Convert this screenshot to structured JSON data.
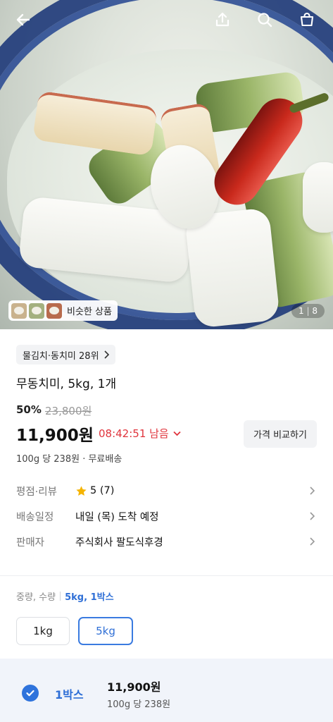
{
  "hero": {
    "similar_label": "비슷한 상품",
    "counter_current": "1",
    "counter_total": "8"
  },
  "icons": {
    "back": "back-arrow-icon",
    "share": "share-icon",
    "search": "search-icon",
    "cart": "cart-icon"
  },
  "product": {
    "category_rank": "물김치·동치미 28위",
    "title": "무동치미, 5kg, 1개",
    "discount": "50%",
    "original_price": "23,800원",
    "price": "11,900원",
    "timer": "08:42:51 남음",
    "compare_label": "가격 비교하기",
    "per_unit": "100g 당 238원 · 무료배송"
  },
  "rows": [
    {
      "key": "평점·리뷰",
      "value": "5 (7)"
    },
    {
      "key": "배송일정",
      "value": "내일 (목) 도착 예정"
    },
    {
      "key": "판매자",
      "value": "주식회사 팔도식후경"
    }
  ],
  "options": {
    "header_key": "중량, 수량",
    "header_value": "5kg, 1박스",
    "weights": [
      "1kg",
      "5kg"
    ],
    "selected_weight": "5kg"
  },
  "selected_item": {
    "label": "1박스",
    "price": "11,900원",
    "per_unit": "100g 당 238원"
  },
  "colors": {
    "accent": "#2f6fd6",
    "timer": "#e0343c",
    "star": "#f5b400"
  }
}
